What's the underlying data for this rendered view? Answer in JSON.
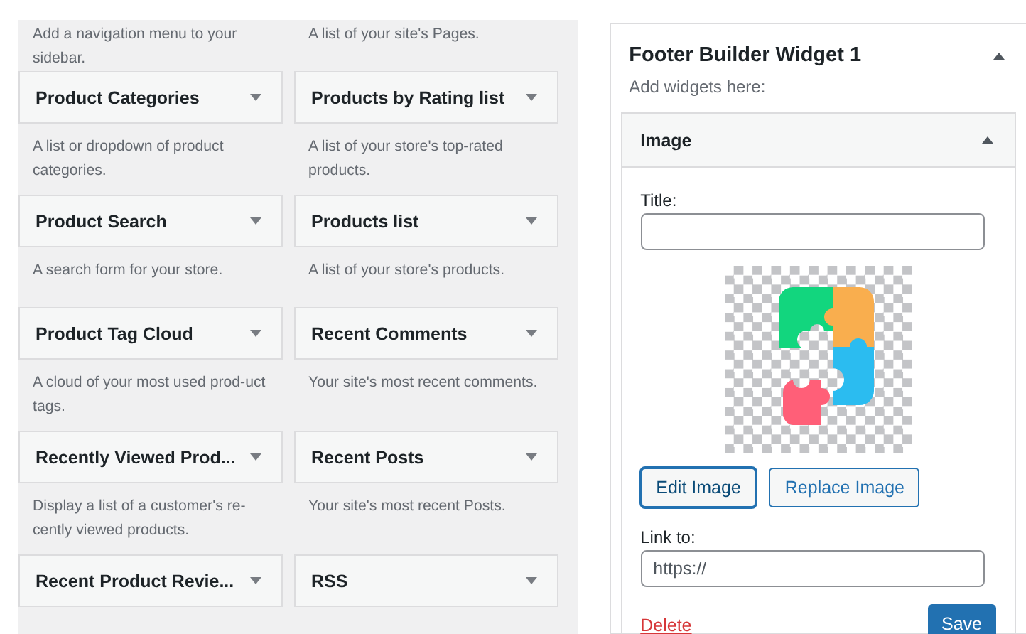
{
  "top_descriptions": [
    "Add a navigation menu to your sidebar.",
    "A list of your site's Pages."
  ],
  "widgets": [
    {
      "title": "Product Categories",
      "expanded": false,
      "description": "A list or dropdown of product categories."
    },
    {
      "title": "Products by Rating list",
      "expanded": false,
      "description": "A list of your store's top-rated products."
    },
    {
      "title": "Product Search",
      "expanded": false,
      "description": "A search form for your store."
    },
    {
      "title": "Products list",
      "expanded": false,
      "description": "A list of your store's products."
    },
    {
      "title": "Product Tag Cloud",
      "expanded": false,
      "description": "A cloud of your most used prod-uct tags."
    },
    {
      "title": "Recent Comments",
      "expanded": false,
      "description": "Your site's most recent comments."
    },
    {
      "title": "Recently Viewed Prod...",
      "expanded": false,
      "description": "Display a list of a customer's re-cently viewed products."
    },
    {
      "title": "Recent Posts",
      "expanded": false,
      "description": "Your site's most recent Posts."
    },
    {
      "title": "Recent Product Revie...",
      "expanded": false
    },
    {
      "title": "RSS",
      "expanded": false
    }
  ],
  "sidebar_area": {
    "title": "Footer Builder Widget 1",
    "expanded": true,
    "description": "Add widgets here:",
    "widget": {
      "title": "Image",
      "expanded": true,
      "title_label": "Title:",
      "edit_button": "Edit Image",
      "replace_button": "Replace Image",
      "link_label": "Link to:",
      "link_value": "https://",
      "delete_link": "Delete",
      "save_button": "Save"
    }
  }
}
